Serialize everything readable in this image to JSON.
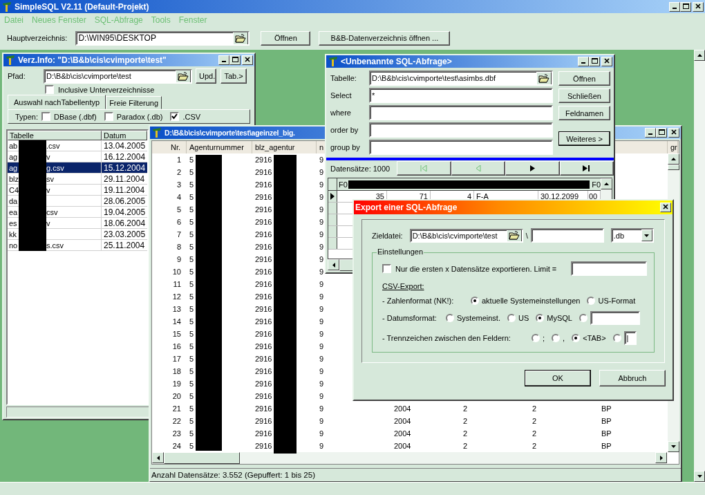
{
  "app": {
    "title": "SimpleSQL V2.11 (Default-Projekt)"
  },
  "menu": [
    {
      "label": "Datei",
      "disabled": true
    },
    {
      "label": "Neues Fenster",
      "disabled": true
    },
    {
      "label": "SQL-Abfrage",
      "disabled": true
    },
    {
      "label": "Tools",
      "disabled": true
    },
    {
      "label": "Fenster",
      "disabled": true
    }
  ],
  "toolbar": {
    "label": "Hauptverzeichnis:",
    "path": "D:\\WIN95\\DESKTOP",
    "buttons": [
      "Öffnen",
      "B&B-Datenverzeichnis öffnen ..."
    ]
  },
  "dir_window": {
    "title": "Verz.Info: \"D:\\B&b\\cis\\cvimporte\\test\"",
    "path_label": "Pfad:",
    "path": "D:\\B&b\\cis\\cvimporte\\test",
    "buttons": [
      "Upd.",
      "Tab.>"
    ],
    "subdirs": {
      "label": "Inclusive Unterverzeichnisse",
      "checked": false
    },
    "tabs": [
      {
        "label": "Auswahl nachTabellentyp",
        "selected": true
      },
      {
        "label": "Freie Filterung",
        "selected": false
      }
    ],
    "types_label": "Typen:",
    "types": [
      {
        "label": "DBase (.dbf)",
        "checked": false
      },
      {
        "label": "Paradox (.db)",
        "checked": false
      },
      {
        "label": ".CSV",
        "checked": true
      }
    ],
    "columns": [
      "Tabelle",
      "Datum"
    ],
    "rows": [
      {
        "name_start": "ab",
        "name_end": ".csv",
        "date": "13.04.2005",
        "selected": false
      },
      {
        "name_start": "ag",
        "name_end": "v",
        "date": "16.12.2004",
        "selected": false
      },
      {
        "name_start": "ag",
        "name_end": "g.csv",
        "date": "15.12.2004",
        "selected": true
      },
      {
        "name_start": "blz",
        "name_end": "sv",
        "date": "29.11.2004",
        "selected": false
      },
      {
        "name_start": "C4",
        "name_end": "v",
        "date": "19.11.2004",
        "selected": false
      },
      {
        "name_start": "da",
        "date": "28.06.2005",
        "selected": false
      },
      {
        "name_start": "ea",
        "name_end": "csv",
        "date": "19.04.2005",
        "selected": false
      },
      {
        "name_start": "es",
        "name_end": "v",
        "date": "18.06.2004",
        "selected": false
      },
      {
        "name_start": "kk",
        "date": "23.03.2005",
        "selected": false
      },
      {
        "name_start": "no",
        "name_end": "s.csv",
        "date": "25.11.2004",
        "selected": false
      }
    ]
  },
  "table_window": {
    "title": "D:\\B&b\\cis\\cvimporte\\test\\ageinzel_big.",
    "columns": [
      "Nr.",
      "Agenturnummer",
      "blz_agentur",
      "n"
    ],
    "last_column": "gr",
    "rows": [
      [
        "1",
        "5",
        "2916",
        "9"
      ],
      [
        "2",
        "5",
        "2916",
        "9"
      ],
      [
        "3",
        "5",
        "2916",
        "9"
      ],
      [
        "4",
        "5",
        "2916",
        "9"
      ],
      [
        "5",
        "5",
        "2916",
        "9"
      ],
      [
        "6",
        "5",
        "2916",
        "9"
      ],
      [
        "7",
        "5",
        "2916",
        "9"
      ],
      [
        "8",
        "5",
        "2916",
        "9"
      ],
      [
        "9",
        "5",
        "2916",
        "9"
      ],
      [
        "10",
        "5",
        "2916",
        "9"
      ],
      [
        "11",
        "5",
        "2916",
        "9"
      ],
      [
        "12",
        "5",
        "2916",
        "9"
      ],
      [
        "13",
        "5",
        "2916",
        "9"
      ],
      [
        "14",
        "5",
        "2916",
        "9"
      ],
      [
        "15",
        "5",
        "2916",
        "9"
      ],
      [
        "16",
        "5",
        "2916",
        "9"
      ],
      [
        "17",
        "5",
        "2916",
        "9"
      ],
      [
        "18",
        "5",
        "2916",
        "9"
      ],
      [
        "19",
        "5",
        "2916",
        "9"
      ],
      [
        "20",
        "5",
        "2916",
        "9"
      ],
      [
        "21",
        "5",
        "2916",
        "9",
        "2004",
        "2",
        "2",
        "BP"
      ],
      [
        "22",
        "5",
        "2916",
        "9",
        "2004",
        "2",
        "2",
        "BP"
      ],
      [
        "23",
        "5",
        "2916",
        "9",
        "2004",
        "2",
        "2",
        "BP"
      ],
      [
        "24",
        "5",
        "2916",
        "9",
        "2004",
        "2",
        "2",
        "BP"
      ]
    ],
    "status": "Anzahl Datensätze: 3.552 (Gepuffert: 1 bis 25)"
  },
  "sql_window": {
    "title": "<Unbenannte SQL-Abfrage>",
    "fields": [
      {
        "label": "Tabelle:",
        "value": "D:\\B&b\\cis\\cvimporte\\test\\asimbs.dbf",
        "browse": true
      },
      {
        "label": "Select",
        "value": "*"
      },
      {
        "label": "where"
      },
      {
        "label": "order by"
      },
      {
        "label": "group by"
      }
    ],
    "buttons": [
      "Öffnen",
      "Schließen",
      "Feldnamen",
      "Weiteres >"
    ],
    "record_count": "Datensätze: 1000",
    "nav": [
      {
        "kind": "first",
        "disabled": true
      },
      {
        "kind": "prev",
        "disabled": true
      },
      {
        "kind": "next",
        "disabled": false
      },
      {
        "kind": "last",
        "disabled": false
      }
    ],
    "grid": {
      "first_column": "F0",
      "last_column": "F0",
      "rows": [
        [
          "35",
          "71",
          "4",
          "F-A",
          "30.12.2099",
          "00"
        ]
      ]
    }
  },
  "export_dialog": {
    "title": "Export einer SQL-Abfrage",
    "target_label": "Zieldatei:",
    "target_dir": "D:\\B&b\\cis\\cvimporte\\test",
    "separator": "\\",
    "extension": ".db",
    "group_title": "Einstellungen",
    "limit": {
      "label": "Nur die ersten x Datensätze exportieren. Limit =",
      "checked": false
    },
    "csv_heading": "CSV-Export:",
    "option_rows": [
      {
        "label": "- Zahlenformat (NK!):",
        "options": [
          {
            "kind": "option",
            "label": "aktuelle Systemeinstellungen",
            "selected": true
          },
          {
            "kind": "option",
            "label": "US-Format",
            "selected": false
          }
        ]
      },
      {
        "label": "- Datumsformat:",
        "options": [
          {
            "kind": "option",
            "label": "Systemeinst.",
            "selected": false
          },
          {
            "kind": "option",
            "label": "US",
            "selected": false
          },
          {
            "kind": "option",
            "label": "MySQL",
            "selected": true
          },
          {
            "kind": "custom",
            "selected": false
          }
        ]
      },
      {
        "label": "- Trennzeichen zwischen den Feldern:",
        "options": [
          {
            "kind": "option",
            "label": ";",
            "selected": false
          },
          {
            "kind": "option",
            "label": ",",
            "selected": false
          },
          {
            "kind": "option",
            "label": "<TAB>",
            "selected": true
          },
          {
            "kind": "custom",
            "value": "|",
            "selected": false
          }
        ]
      }
    ],
    "buttons": [
      {
        "label": "OK",
        "default": true
      },
      {
        "label": "Abbruch",
        "default": false
      }
    ]
  }
}
